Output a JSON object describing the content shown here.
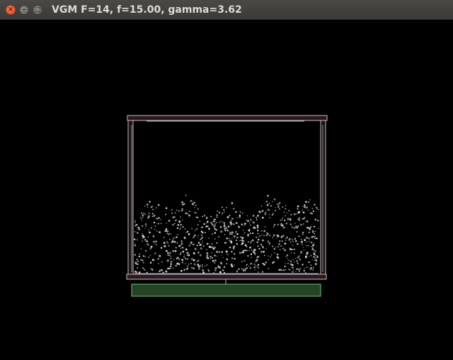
{
  "window": {
    "title": "VGM F=14, f=15.00, gamma=3.62",
    "buttons": {
      "close_glyph": "×",
      "minimize_glyph": "–",
      "maximize_glyph": "□"
    }
  },
  "scene": {
    "background": "#000000",
    "frame_color": "#c9b9be",
    "frame_fill": "#2a1a1f",
    "inner_wall_color": "#9aa3a8",
    "particle_color": "#c8c8c8",
    "progress_bar": {
      "fill": "#264326",
      "border": "#6fbf7a"
    }
  }
}
